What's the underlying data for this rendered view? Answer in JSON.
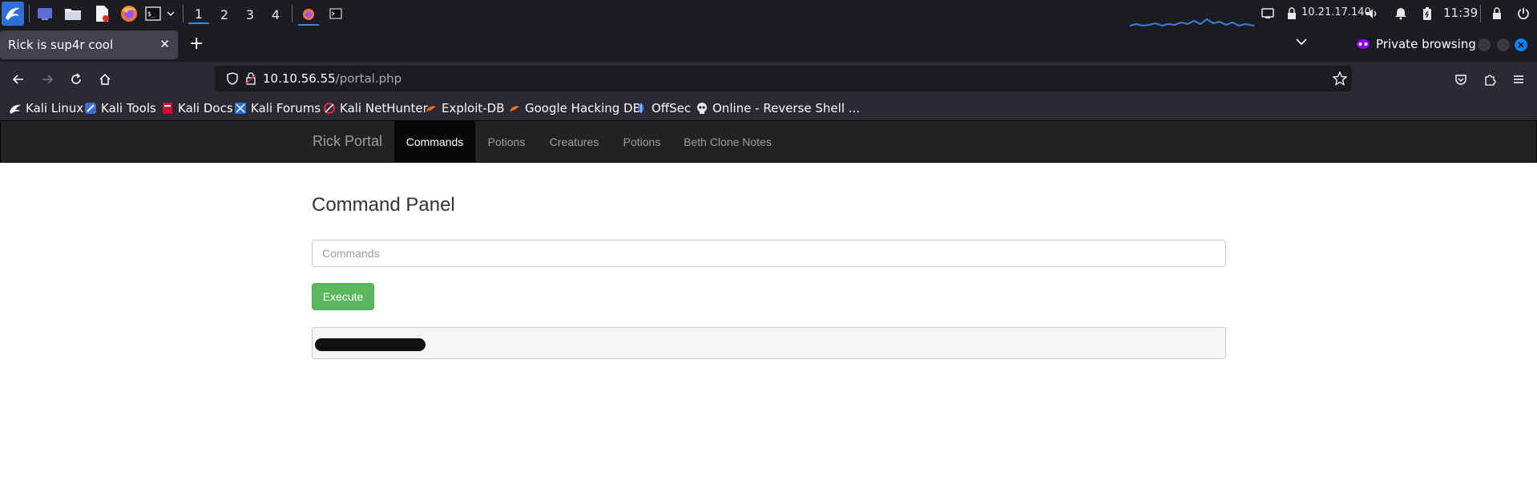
{
  "taskbar": {
    "workspaces": [
      "1",
      "2",
      "3",
      "4"
    ],
    "ip_address": "10.21.17.140",
    "clock": "11:39",
    "icons": [
      "kali-menu-icon",
      "desktop-icon",
      "file-manager-icon",
      "text-editor-icon",
      "firefox-icon",
      "terminal-icon",
      "chevron-down-icon",
      "firefox-window-icon",
      "terminal-window-icon",
      "network-monitor-icon",
      "vpn-icon",
      "volume-icon",
      "notifications-icon",
      "battery-icon",
      "lock-icon",
      "power-icon"
    ]
  },
  "browser": {
    "tab_title": "Rick is sup4r cool",
    "private_label": "Private browsing",
    "url_host": "10.10.56.55",
    "url_path": "/portal.php",
    "bookmarks": [
      {
        "label": "Kali Linux",
        "icon": "kali-dragon-icon"
      },
      {
        "label": "Kali Tools",
        "icon": "kali-tools-icon"
      },
      {
        "label": "Kali Docs",
        "icon": "kali-docs-icon"
      },
      {
        "label": "Kali Forums",
        "icon": "kali-forums-icon"
      },
      {
        "label": "Kali NetHunter",
        "icon": "nethunter-icon"
      },
      {
        "label": "Exploit-DB",
        "icon": "exploit-db-icon"
      },
      {
        "label": "Google Hacking DB",
        "icon": "ghdb-icon"
      },
      {
        "label": "OffSec",
        "icon": "offsec-icon"
      },
      {
        "label": "Online - Reverse Shell ...",
        "icon": "skull-icon"
      }
    ],
    "colors": {
      "chrome_dark": "#1c1b22",
      "toolbar": "#2b2a33",
      "tab_active": "#42414d",
      "private_purple": "#8f00ff",
      "close_blue": "#0a84ff"
    }
  },
  "site": {
    "brand": "Rick Portal",
    "nav": [
      "Commands",
      "Potions",
      "Creatures",
      "Potions",
      "Beth Clone Notes"
    ],
    "active_nav": "Commands",
    "panel_title": "Command Panel",
    "input_placeholder": "Commands",
    "input_value": "",
    "execute_label": "Execute",
    "output_redacted": true,
    "colors": {
      "navbar": "#222222",
      "nav_active": "#080808",
      "execute_button": "#5cb85c",
      "output_bg": "#f5f5f5"
    }
  }
}
